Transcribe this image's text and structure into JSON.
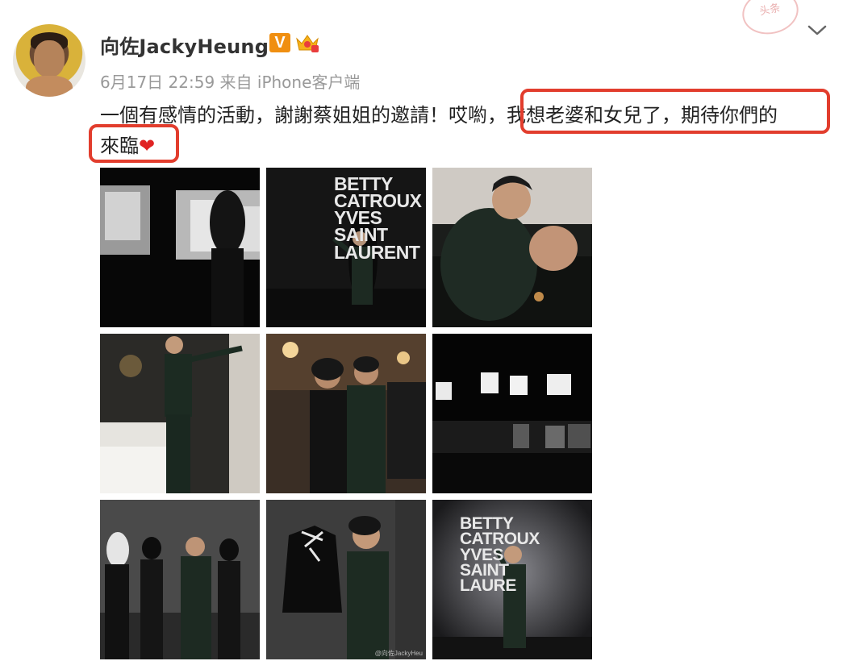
{
  "user": {
    "name": "向佐JackyHeung",
    "verified_badge": "V",
    "avatar_icon": "avatar",
    "crown_icon": "vip-crown-icon"
  },
  "post": {
    "meta": "6月17日 22:59 来自 iPhone客户端",
    "text_line1_a": "一個有感情的活動，謝謝蔡姐姐的邀請！哎喲，",
    "text_line1_b": "我想老婆和女兒了，期待你們的",
    "text_line2": "來臨",
    "heart": "❤"
  },
  "ui": {
    "expand_icon": "chevron-down-icon",
    "stamp_text": "头条"
  },
  "photos": {
    "p2_text": "BETTY\nCATROUX\nYVES\nSAINT\nLAURENT",
    "p9_text": "BETTY\nCATROUX\nYVES\nSAINT\nLAURE",
    "p8_watermark": "@向佐JackyHeu"
  },
  "colors": {
    "highlight": "#e23d2d",
    "badge": "#f08f11",
    "meta_gray": "#999999"
  }
}
